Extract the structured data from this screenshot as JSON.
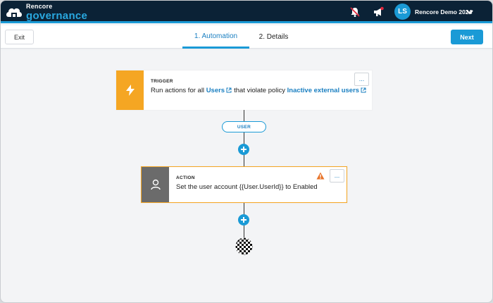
{
  "app": {
    "logo_small": "Rencore",
    "logo_big": "governance",
    "user_initials": "LS",
    "user_name": "Rencore Demo 2024"
  },
  "toolbar": {
    "exit_label": "Exit",
    "tabs": [
      {
        "label": "1. Automation",
        "active": true
      },
      {
        "label": "2. Details",
        "active": false
      }
    ],
    "next_label": "Next"
  },
  "trigger": {
    "kind": "TRIGGER",
    "text_prefix": "Run actions for all",
    "link_users": "Users",
    "text_middle": "that violate policy",
    "link_policy": "Inactive external users",
    "menu_label": "..."
  },
  "scope_label": "USER",
  "action": {
    "kind": "ACTION",
    "text": "Set the user account {{User.UserId}} to Enabled",
    "menu_label": "..."
  },
  "icons": {
    "notifications": "bell-slash-icon",
    "announcements": "megaphone-icon",
    "trigger": "lightning-bolt-icon",
    "action": "person-icon",
    "warning": "warning-icon",
    "end": "finish-flag-icon"
  },
  "colors": {
    "topbar": "#0b2236",
    "accent": "#1a9ad6",
    "trigger": "#f5a623",
    "action": "#6b6b6b",
    "warning": "#e8742a"
  }
}
